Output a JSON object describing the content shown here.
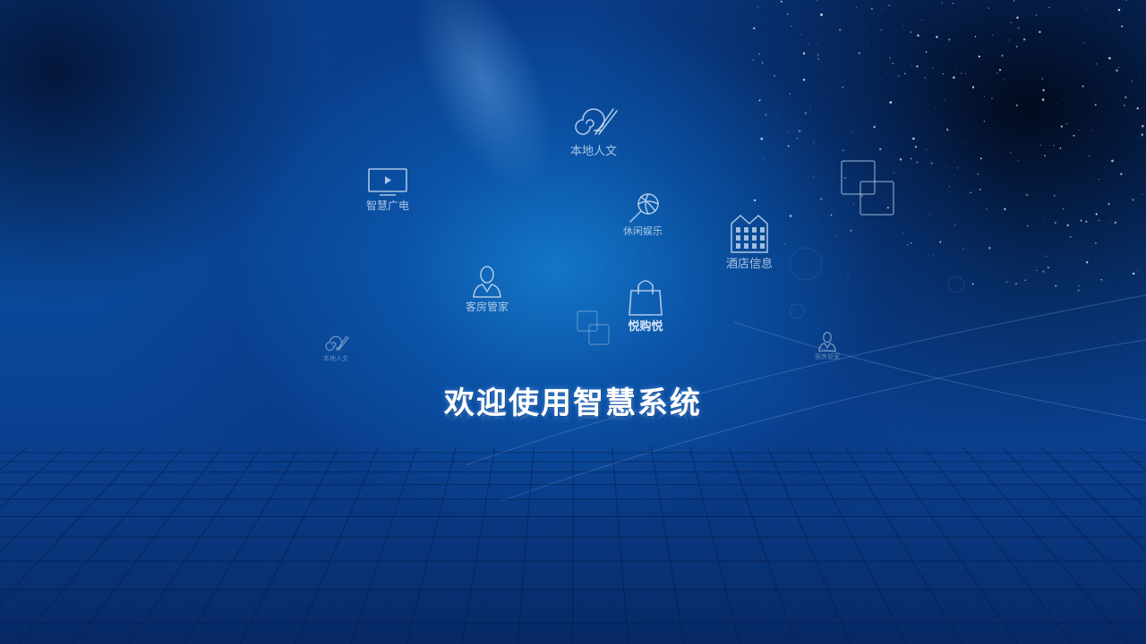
{
  "screen": {
    "welcome_title": "欢迎使用智慧系统"
  },
  "menu": {
    "local_culture": {
      "label": "本地人文",
      "icon": "snail-brush-icon"
    },
    "smart_tv": {
      "label": "智慧广电",
      "icon": "tv-icon"
    },
    "leisure": {
      "label": "休闲娱乐",
      "icon": "lollipop-icon"
    },
    "hotel_info": {
      "label": "酒店信息",
      "icon": "building-icon"
    },
    "housekeeper": {
      "label": "客房管家",
      "icon": "person-icon"
    },
    "shopping": {
      "label": "悦购悦",
      "icon": "shopping-bag-icon"
    },
    "local_culture_small": {
      "label": "本地人文",
      "icon": "snail-brush-icon"
    },
    "housekeeper_small": {
      "label": "客房管家",
      "icon": "person-icon"
    }
  },
  "colors": {
    "background_center": "#0b6ab8",
    "background_edge": "#06205a",
    "icon_stroke": "#c8dcf0",
    "title_text": "#ffffff"
  }
}
